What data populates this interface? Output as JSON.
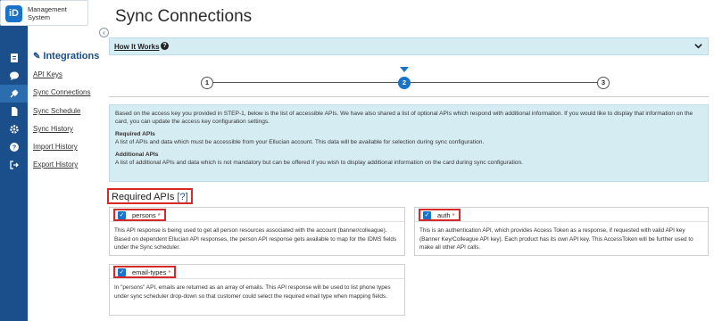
{
  "app": {
    "logo_letters": "iD",
    "logo_line1": "Management",
    "logo_line2": "System"
  },
  "rail_icons": [
    "document-icon",
    "chat-icon",
    "plug-icon",
    "file-icon",
    "gear-icon",
    "help-icon",
    "logout-icon"
  ],
  "sidebar": {
    "title": "Integrations",
    "links": [
      "API Keys",
      "Sync Connections",
      "Sync Schedule",
      "Sync History",
      "Import History",
      "Export History"
    ]
  },
  "page": {
    "title": "Sync Connections"
  },
  "how_it_works": {
    "label": "How It Works",
    "help": "?",
    "chevron": "⌄"
  },
  "stepper": {
    "steps": [
      "1",
      "2",
      "3"
    ],
    "active_step": 2
  },
  "info": {
    "intro": "Based on the access key you provided in STEP-1, below is the list of accessible APIs. We have also shared a list of optional APIs which respond with additional information. If you would like to display that information on the card, you can update the access key configuration settings.",
    "required_heading": "Required APIs",
    "required_text": "A list of APIs and data which must be accessible from your Ellucian account. This data will be available for selection during sync configuration.",
    "additional_heading": "Additional APIs",
    "additional_text": "A list of additional APIs and data which is not mandatory but can be offered if you wish to display additional information on the card during sync configuration."
  },
  "required_apis": {
    "title": "Required APIs",
    "help": "[?]",
    "cards": [
      {
        "name": "persons",
        "star": "*",
        "checked": true,
        "description": "This API response is being used to get all person resources associated with the account (banner/colleague). Based on dependent Ellucian API responses, the person API response gets available to map for the IDMS fields under the Sync scheduler."
      },
      {
        "name": "auth",
        "star": "*",
        "checked": true,
        "description": "This is an authentication API, which provides Access Token as a response, if requested with valid API key (Banner Key/Colleague API key). Each product has its own API key. This AccessToken will be further used to make all other API calls."
      },
      {
        "name": "email-types",
        "star": "*",
        "checked": true,
        "description": "In \"persons\" API, emails are returned as an array of emails. This API response will be used to list phone types under sync scheduler drop-down so that customer could select the required email type when mapping fields."
      }
    ]
  },
  "colors": {
    "rail": "#1a4f8c",
    "accent": "#1a73c8",
    "info_bg": "#d6ecf3",
    "highlight": "#d62a2a"
  }
}
